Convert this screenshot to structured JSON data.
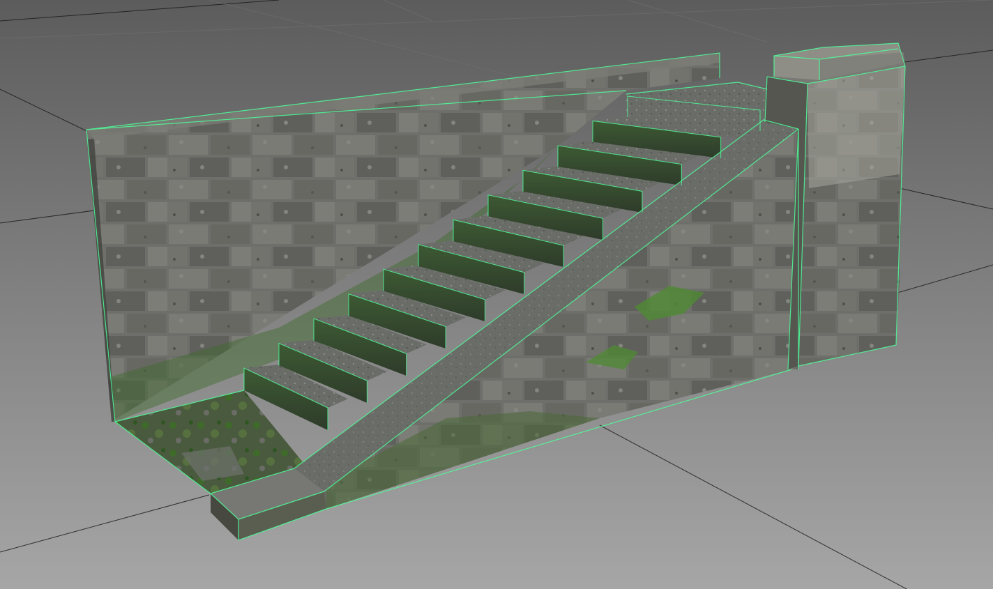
{
  "viewport": {
    "type": "3d-perspective",
    "background_top_color": "#5c5c5c",
    "background_bottom_color": "#a6a6a6",
    "grid_line_color": "#1a1a1a",
    "wireframe_color": "#4dff9a",
    "selection_state": "selected",
    "shading": "textured-with-wireframe-overlay"
  },
  "model": {
    "object": "stone-staircase",
    "step_count": 12,
    "components": [
      "back-wall",
      "ground-slab",
      "stairs",
      "stringer-ramp",
      "side-wall",
      "pillar",
      "landing",
      "bottom-block"
    ],
    "materials": {
      "stone_color": "#6f706b",
      "stone_dark_color": "#4f524b",
      "moss_color": "#3f6a2c",
      "tread_color": "#6a6d69"
    }
  }
}
